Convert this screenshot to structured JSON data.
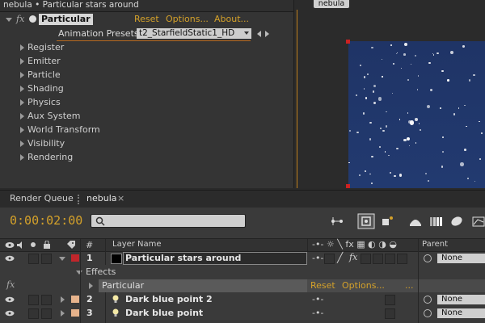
{
  "effect_controls": {
    "title": "nebula • Particular stars around",
    "effect_name": "Particular",
    "fx_label": "fx",
    "reset": "Reset",
    "options": "Options...",
    "about": "About...",
    "presets_label": "Animation Presets:",
    "presets_value": "t2_StarfieldStatic1_HD",
    "groups": [
      "Register",
      "Emitter",
      "Particle",
      "Shading",
      "Physics",
      "Aux System",
      "World Transform",
      "Visibility",
      "Rendering"
    ]
  },
  "viewer": {
    "tab": "nebula"
  },
  "timeline": {
    "tabs": [
      "Render Queue",
      "nebula"
    ],
    "close_glyph": "×",
    "timecode": "0:00:02:00",
    "search_placeholder": "",
    "headers": {
      "num": "#",
      "layer_name": "Layer Name",
      "parent": "Parent"
    },
    "layers": [
      {
        "num": "1",
        "name": "Particular stars around",
        "color": "#c0262b",
        "parent": "None"
      },
      {
        "num": "2",
        "name": "Dark blue point 2",
        "color": "#e6b38c",
        "parent": "None"
      },
      {
        "num": "3",
        "name": "Dark blue point",
        "color": "#e6b38c",
        "parent": "None"
      }
    ],
    "effects_label": "Effects",
    "effect_row": {
      "name": "Particular",
      "reset": "Reset",
      "options": "Options...",
      "dots": "..."
    }
  },
  "colors": {
    "accent": "#d4a12a",
    "canvas": "#213768",
    "selected_label": "#c0262b"
  }
}
